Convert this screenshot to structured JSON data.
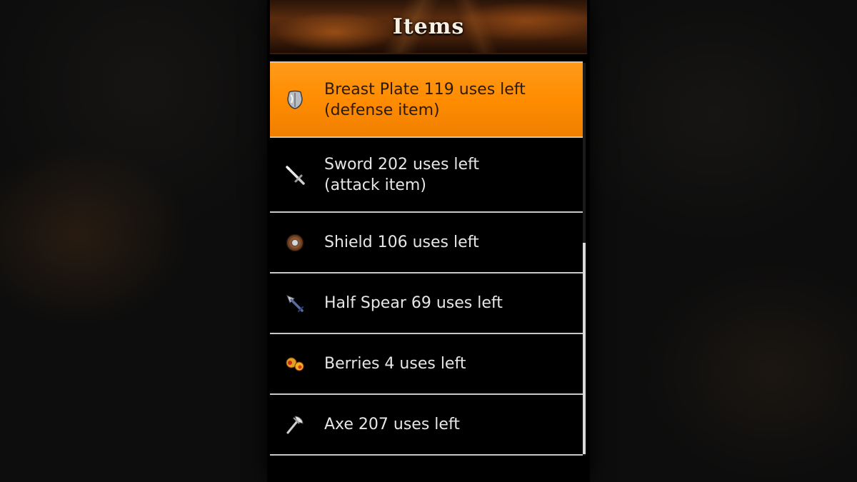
{
  "header": {
    "title": "Items"
  },
  "items": [
    {
      "name_line": "Breast Plate 119 uses left",
      "type_line": "(defense item)",
      "icon": "breastplate-icon",
      "selected": true
    },
    {
      "name_line": "Sword 202 uses left",
      "type_line": "(attack item)",
      "icon": "sword-icon",
      "selected": false
    },
    {
      "name_line": "Shield 106 uses left",
      "icon": "shield-icon",
      "selected": false
    },
    {
      "name_line": "Half Spear 69 uses left",
      "icon": "spear-icon",
      "selected": false
    },
    {
      "name_line": "Berries 4 uses left",
      "icon": "berries-icon",
      "selected": false
    },
    {
      "name_line": "Axe 207 uses left",
      "icon": "axe-icon",
      "selected": false
    }
  ],
  "colors": {
    "selected_background": "#ff8c00",
    "list_background": "#000000",
    "text": "#e6e6e6",
    "divider": "#c8c8c8"
  }
}
